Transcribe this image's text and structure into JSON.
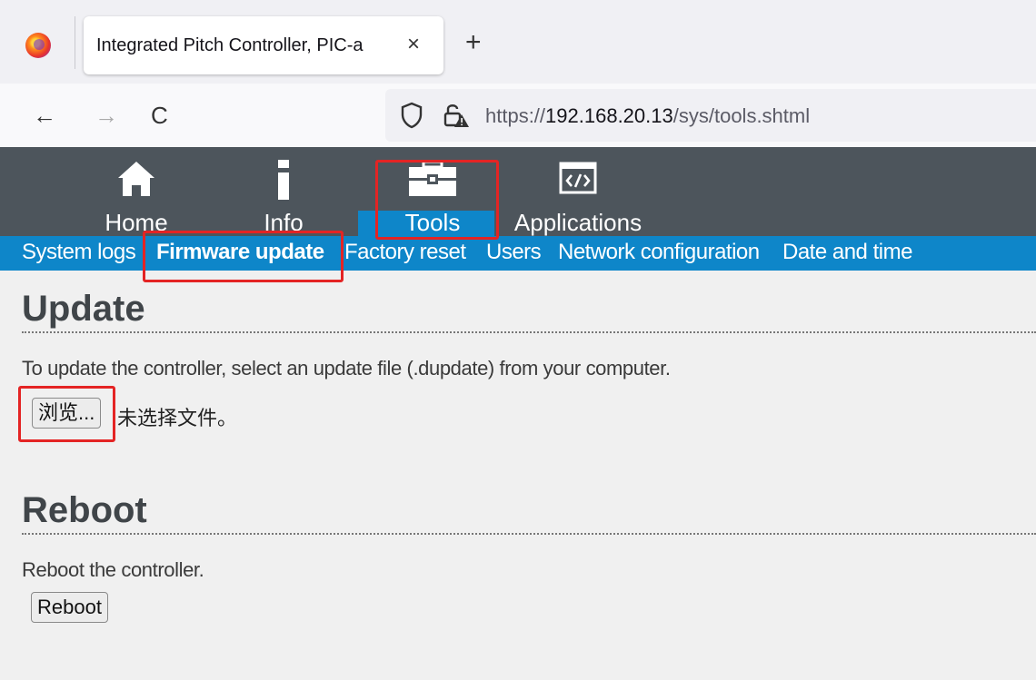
{
  "browser": {
    "tab_title": "Integrated Pitch Controller, PIC-a",
    "tab_close": "×",
    "new_tab": "+",
    "back": "←",
    "forward": "→",
    "reload": "C",
    "url_scheme": "https://",
    "url_host": "192.168.20.13",
    "url_path": "/sys/tools.shtml"
  },
  "header": {
    "tabs": [
      {
        "label": "Home",
        "icon": "home-icon"
      },
      {
        "label": "Info",
        "icon": "info-icon"
      },
      {
        "label": "Tools",
        "icon": "toolbox-icon"
      },
      {
        "label": "Applications",
        "icon": "code-window-icon"
      }
    ],
    "active_tab": "Tools"
  },
  "subnav": {
    "items": [
      "System logs",
      "Firmware update",
      "Factory reset",
      "Users",
      "Network configuration",
      "Date and time"
    ],
    "active": "Firmware update"
  },
  "update": {
    "heading": "Update",
    "description": "To update the controller, select an update file (.dupdate) from your computer.",
    "browse_label": "浏览...",
    "no_file_text": "未选择文件。"
  },
  "reboot": {
    "heading": "Reboot",
    "description": "Reboot the controller.",
    "button_label": "Reboot"
  },
  "colors": {
    "header_bg": "#4d555c",
    "subnav_bg": "#0e86c9",
    "highlight": "#e42424"
  }
}
